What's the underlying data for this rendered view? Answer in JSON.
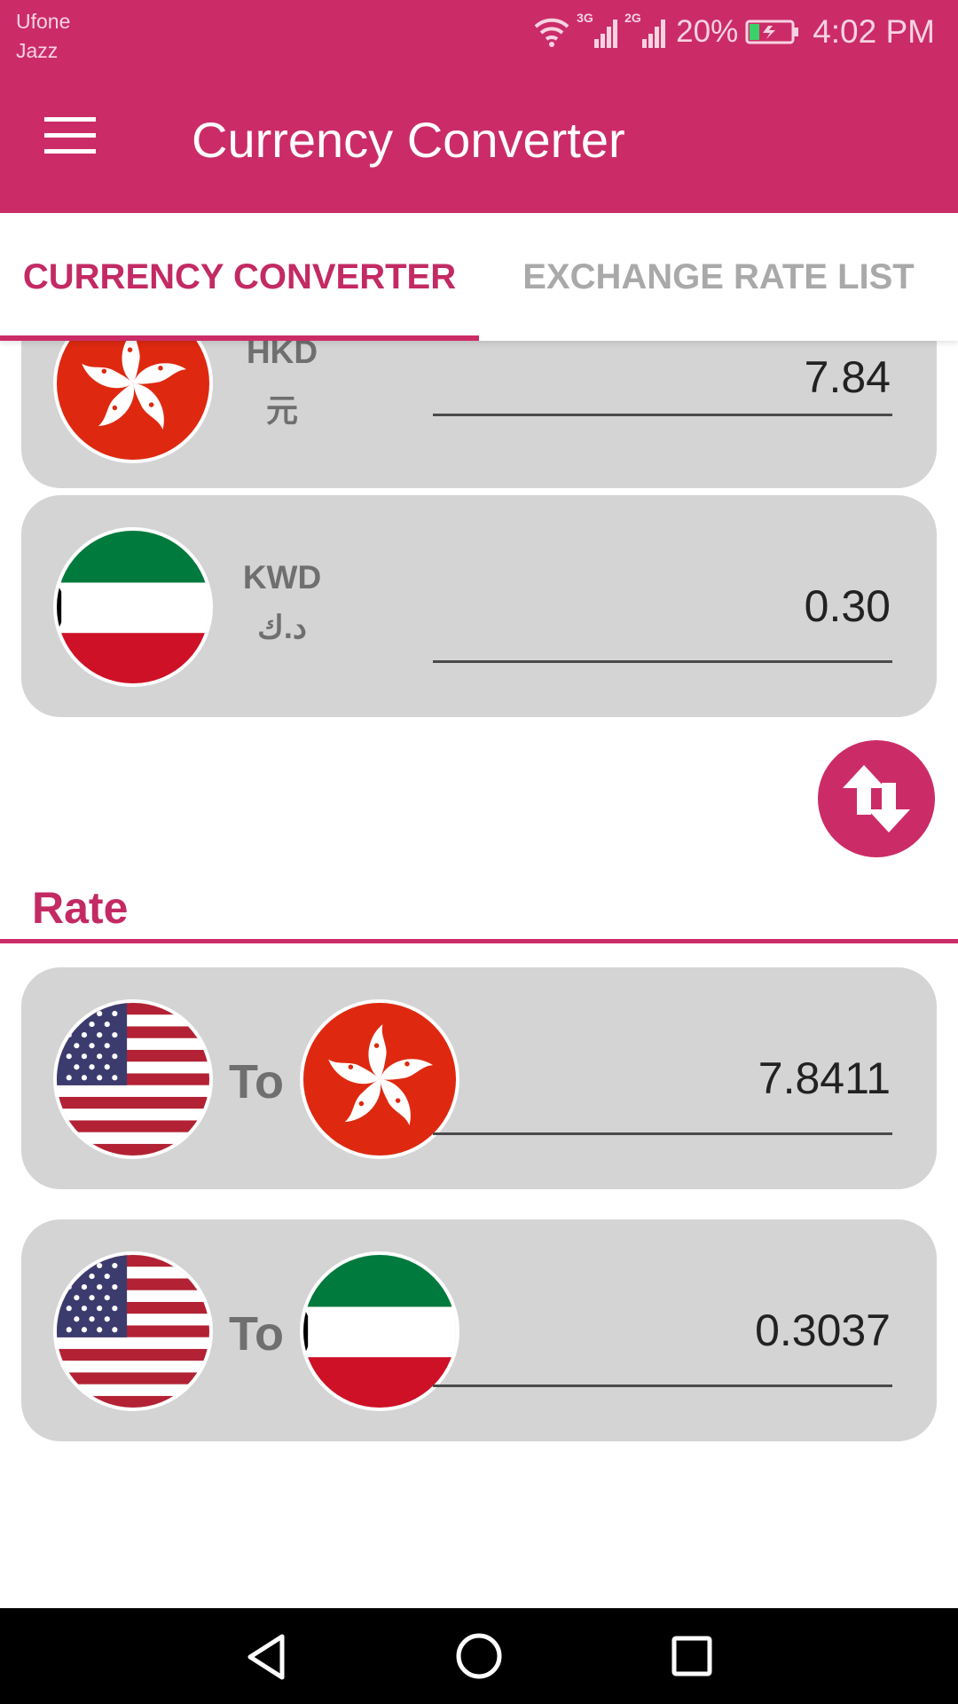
{
  "status_bar": {
    "carrier_1": "Ufone",
    "carrier_2": "Jazz",
    "net_1": "3G",
    "net_2": "2G",
    "battery": "20%",
    "time": "4:02 PM"
  },
  "app_bar": {
    "title": "Currency Converter",
    "menu_icon": "hamburger-menu-icon"
  },
  "tabs": [
    {
      "label": "CURRENCY CONVERTER",
      "active": true
    },
    {
      "label": "EXCHANGE RATE LIST",
      "active": false
    }
  ],
  "converter": [
    {
      "code": "HKD",
      "symbol": "元",
      "flag": "hong-kong-flag",
      "value": "7.84"
    },
    {
      "code": "KWD",
      "symbol": "د.ك",
      "flag": "kuwait-flag",
      "value": "0.30"
    }
  ],
  "swap_button": {
    "icon": "swap-vertical-icon"
  },
  "rate": {
    "title": "Rate",
    "rows": [
      {
        "from_flag": "usa-flag",
        "to_label": "To",
        "to_flag": "hong-kong-flag",
        "value": "7.8411"
      },
      {
        "from_flag": "usa-flag",
        "to_label": "To",
        "to_flag": "kuwait-flag",
        "value": "0.3037"
      }
    ]
  },
  "colors": {
    "primary": "#cb2c68",
    "card": "#d4d4d4",
    "tab_inactive": "#a9a9a9"
  },
  "nav_bar": {
    "back_icon": "back-triangle-icon",
    "home_icon": "home-circle-icon",
    "recents_icon": "recents-square-icon"
  }
}
